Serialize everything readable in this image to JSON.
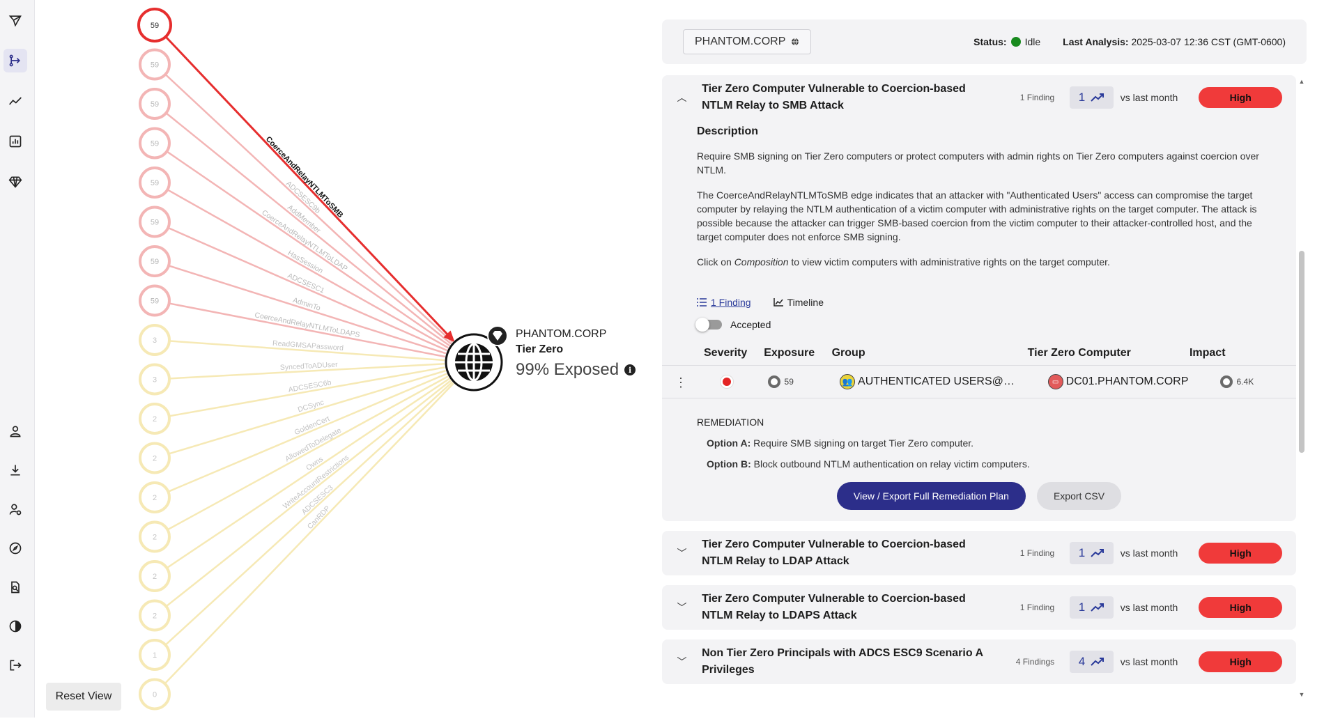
{
  "sidebar": {
    "icons": [
      "logo-icon",
      "attack-paths-icon",
      "trends-icon",
      "reports-icon",
      "tier-zero-icon",
      "user-icon",
      "download-icon",
      "admin-icon",
      "explore-icon",
      "search-doc-icon",
      "theme-icon",
      "logout-icon"
    ]
  },
  "graph": {
    "reset_label": "Reset View",
    "target": {
      "name": "PHANTOM.CORP",
      "tier": "Tier Zero",
      "exposure": "99% Exposed"
    },
    "nodes": [
      {
        "value": "59",
        "state": "selected"
      },
      {
        "value": "59",
        "state": "red"
      },
      {
        "value": "59",
        "state": "red"
      },
      {
        "value": "59",
        "state": "red"
      },
      {
        "value": "59",
        "state": "red"
      },
      {
        "value": "59",
        "state": "red"
      },
      {
        "value": "59",
        "state": "red"
      },
      {
        "value": "59",
        "state": "red"
      },
      {
        "value": "3",
        "state": "yellow"
      },
      {
        "value": "3",
        "state": "yellow"
      },
      {
        "value": "2",
        "state": "yellow"
      },
      {
        "value": "2",
        "state": "yellow"
      },
      {
        "value": "2",
        "state": "yellow"
      },
      {
        "value": "2",
        "state": "yellow"
      },
      {
        "value": "2",
        "state": "yellow"
      },
      {
        "value": "2",
        "state": "yellow"
      },
      {
        "value": "1",
        "state": "yellow"
      },
      {
        "value": "0",
        "state": "yellow"
      }
    ],
    "edges": [
      {
        "label": "CoerceAndRelayNTLMToSMB",
        "state": "selected"
      },
      {
        "label": "ADCSESC9b",
        "state": "red"
      },
      {
        "label": "AddMember",
        "state": "red"
      },
      {
        "label": "CoerceAndRelayNTLMToLDAP",
        "state": "red"
      },
      {
        "label": "HasSession",
        "state": "red"
      },
      {
        "label": "ADCSESC1",
        "state": "red"
      },
      {
        "label": "AdminTo",
        "state": "red"
      },
      {
        "label": "CoerceAndRelayNTLMToLDAPS",
        "state": "red"
      },
      {
        "label": "ReadGMSAPassword",
        "state": "yellow"
      },
      {
        "label": "SyncedToADUser",
        "state": "yellow"
      },
      {
        "label": "ADCSESC6b",
        "state": "yellow"
      },
      {
        "label": "DCSync",
        "state": "yellow"
      },
      {
        "label": "GoldenCert",
        "state": "yellow"
      },
      {
        "label": "AllowedToDelegate",
        "state": "yellow"
      },
      {
        "label": "Owns",
        "state": "yellow"
      },
      {
        "label": "WriteAccountRestrictions",
        "state": "yellow"
      },
      {
        "label": "ADCSESC3",
        "state": "yellow"
      },
      {
        "label": "CanRDP",
        "state": "yellow"
      }
    ]
  },
  "header": {
    "domain": "PHANTOM.CORP",
    "status_label": "Status:",
    "status_value": "Idle",
    "last_analysis_label": "Last Analysis:",
    "last_analysis_value": "2025-03-07 12:36 CST (GMT-0600)"
  },
  "findings": [
    {
      "title": "Tier Zero Computer Vulnerable to Coercion-based NTLM Relay to SMB Attack",
      "count_label": "1 Finding",
      "trend": "1",
      "vs_label": "vs last month",
      "severity": "High",
      "expanded": true
    },
    {
      "title": "Tier Zero Computer Vulnerable to Coercion-based NTLM Relay to LDAP Attack",
      "count_label": "1 Finding",
      "trend": "1",
      "vs_label": "vs last month",
      "severity": "High",
      "expanded": false
    },
    {
      "title": "Tier Zero Computer Vulnerable to Coercion-based NTLM Relay to LDAPS Attack",
      "count_label": "1 Finding",
      "trend": "1",
      "vs_label": "vs last month",
      "severity": "High",
      "expanded": false
    },
    {
      "title": "Non Tier Zero Principals with ADCS ESC9 Scenario A Privileges",
      "count_label": "4 Findings",
      "trend": "4",
      "vs_label": "vs last month",
      "severity": "High",
      "expanded": false
    }
  ],
  "detail": {
    "description_title": "Description",
    "p1": "Require SMB signing on Tier Zero computers or protect computers with admin rights on Tier Zero computers against coercion over NTLM.",
    "p2": "The CoerceAndRelayNTLMToSMB edge indicates that an attacker with \"Authenticated Users\" access can compromise the target computer by relaying the NTLM authentication of a victim computer with administrative rights on the target computer. The attack is possible because the attacker can trigger SMB-based coercion from the victim computer to their attacker-controlled host, and the target computer does not enforce SMB signing.",
    "p3_before": "Click on ",
    "p3_em": "Composition",
    "p3_after": " to view victim computers with administrative rights on the target computer.",
    "tab_findings": "1 Finding",
    "tab_timeline": "Timeline",
    "accepted_label": "Accepted",
    "columns": [
      "Severity",
      "Exposure",
      "Group",
      "Tier Zero Computer",
      "Impact"
    ],
    "row": {
      "exposure": "59",
      "group": "AUTHENTICATED USERS@…",
      "computer": "DC01.PHANTOM.CORP",
      "impact": "6.4K"
    },
    "remediation_title": "REMEDIATION",
    "option_a_label": "Option A:",
    "option_a_text": " Require SMB signing on target Tier Zero computer.",
    "option_b_label": "Option B:",
    "option_b_text": " Block outbound NTLM authentication on relay victim computers.",
    "btn_plan": "View / Export Full Remediation Plan",
    "btn_csv": "Export CSV"
  },
  "colors": {
    "accent": "#2c2e8a",
    "high": "#f03a3a",
    "status_ok": "#188a1e"
  }
}
